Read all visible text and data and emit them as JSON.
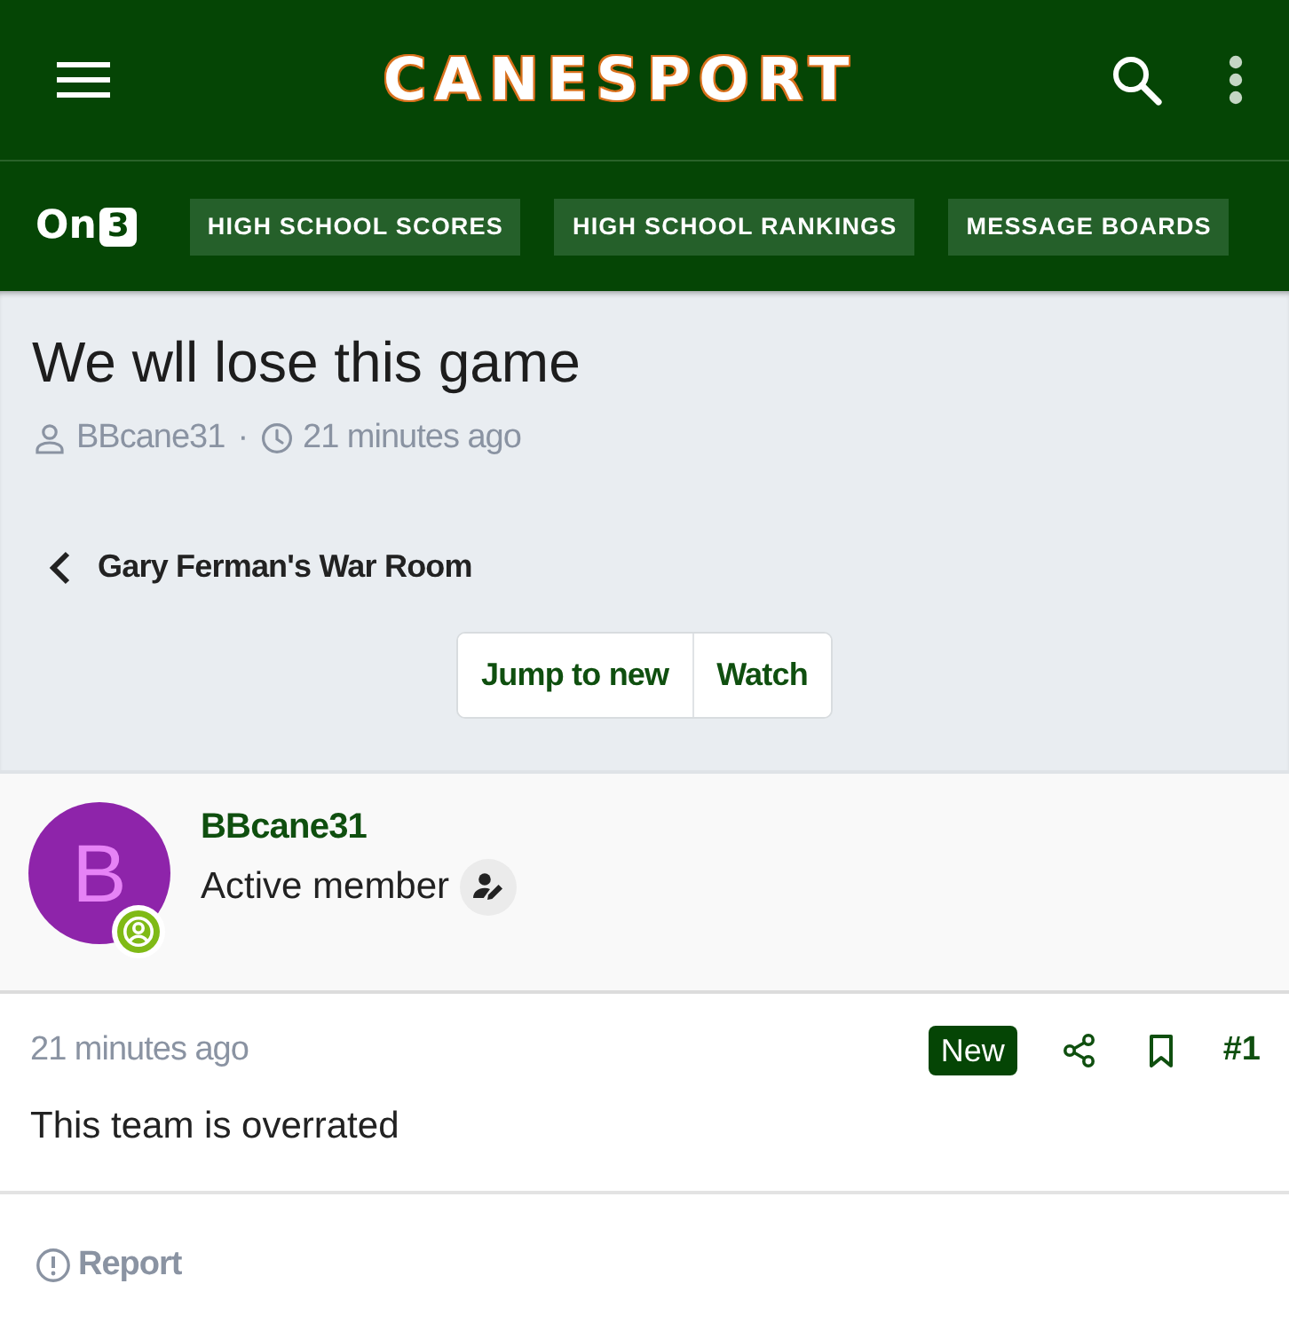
{
  "header": {
    "logo": "CANESPORT"
  },
  "nav": {
    "logo": {
      "text": "On",
      "badge": "3"
    },
    "links": [
      {
        "label": "HIGH SCHOOL SCORES"
      },
      {
        "label": "HIGH SCHOOL RANKINGS"
      },
      {
        "label": "MESSAGE BOARDS"
      }
    ]
  },
  "thread": {
    "title": "We wll lose this game",
    "author": "BBcane31",
    "separator": "·",
    "time": "21 minutes ago",
    "breadcrumb": "Gary Ferman's War Room",
    "actions": [
      {
        "label": "Jump to new"
      },
      {
        "label": "Watch"
      }
    ]
  },
  "post": {
    "author": {
      "initial": "B",
      "name": "BBcane31",
      "role": "Active member",
      "online": true
    },
    "time": "21 minutes ago",
    "badge": "New",
    "number": "#1",
    "body": "This team is overrated",
    "footer_action": "Report"
  }
}
